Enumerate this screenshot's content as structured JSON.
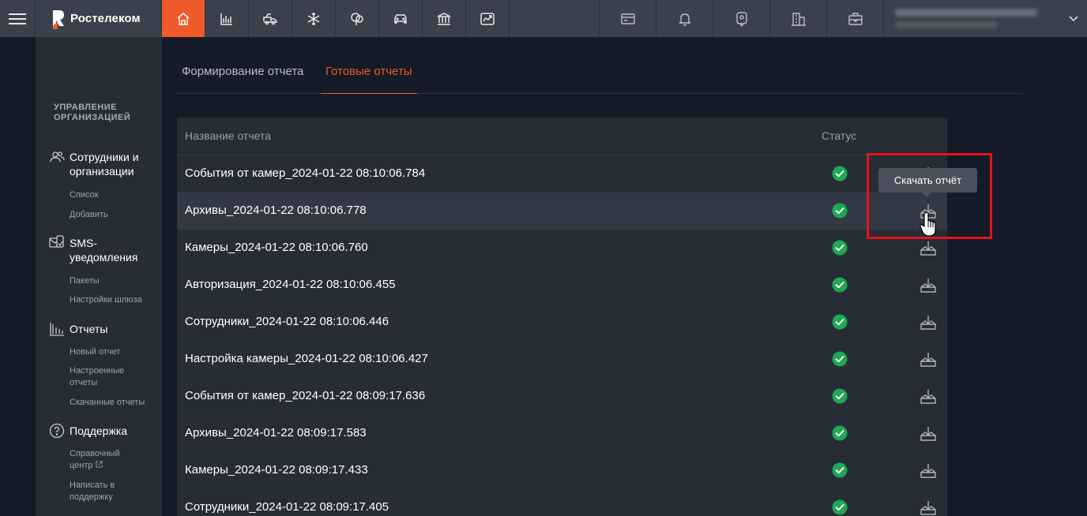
{
  "header": {
    "brand_name": "Ростелеком",
    "nav_icons": [
      "home-icon",
      "bar-chart-icon",
      "truck-icon",
      "snowflake-icon",
      "tree-icon",
      "car-icon",
      "bank-icon",
      "trend-chart-icon"
    ],
    "right_icons": [
      "card-icon",
      "bell-icon",
      "map-marker-icon",
      "building-icon",
      "briefcase-icon"
    ],
    "active_color": "#f05a28"
  },
  "sidebar": {
    "heading_line1": "УПРАВЛЕНИЕ",
    "heading_line2": "ОРГАНИЗАЦИЕЙ",
    "sections": [
      {
        "label_line1": "Сотрудники и",
        "label_line2": "организации",
        "icon": "users-icon",
        "items": [
          "Список",
          "Добавить"
        ]
      },
      {
        "label_line1": "SMS-",
        "label_line2": "уведомления",
        "icon": "sms-icon",
        "items": [
          "Пакеты",
          "Настройки шлюза"
        ]
      },
      {
        "label_line1": "Отчеты",
        "label_line2": "",
        "icon": "report-chart-icon",
        "items": [
          "Новый отчет",
          "Настроенные отчеты",
          "Скачанные отчеты"
        ]
      },
      {
        "label_line1": "Поддержка",
        "label_line2": "",
        "icon": "help-icon",
        "items": [
          "Справочный центр",
          "Написать в поддержку"
        ]
      }
    ]
  },
  "tabs": [
    {
      "label": "Формирование отчета",
      "active": false
    },
    {
      "label": "Готовые отчеты",
      "active": true
    }
  ],
  "table": {
    "columns": {
      "name": "Название отчета",
      "status": "Статус"
    },
    "rows": [
      "События от камер_2024-01-22 08:10:06.784",
      "Архивы_2024-01-22 08:10:06.778",
      "Камеры_2024-01-22 08:10:06.760",
      "Авторизация_2024-01-22 08:10:06.455",
      "Сотрудники_2024-01-22 08:10:06.446",
      "Настройка камеры_2024-01-22 08:10:06.427",
      "События от камер_2024-01-22 08:09:17.636",
      "Архивы_2024-01-22 08:09:17.583",
      "Камеры_2024-01-22 08:09:17.433",
      "Сотрудники_2024-01-22 08:09:17.405"
    ],
    "status_color": "#1fa855"
  },
  "tooltip": {
    "text": "Скачать отчёт"
  }
}
